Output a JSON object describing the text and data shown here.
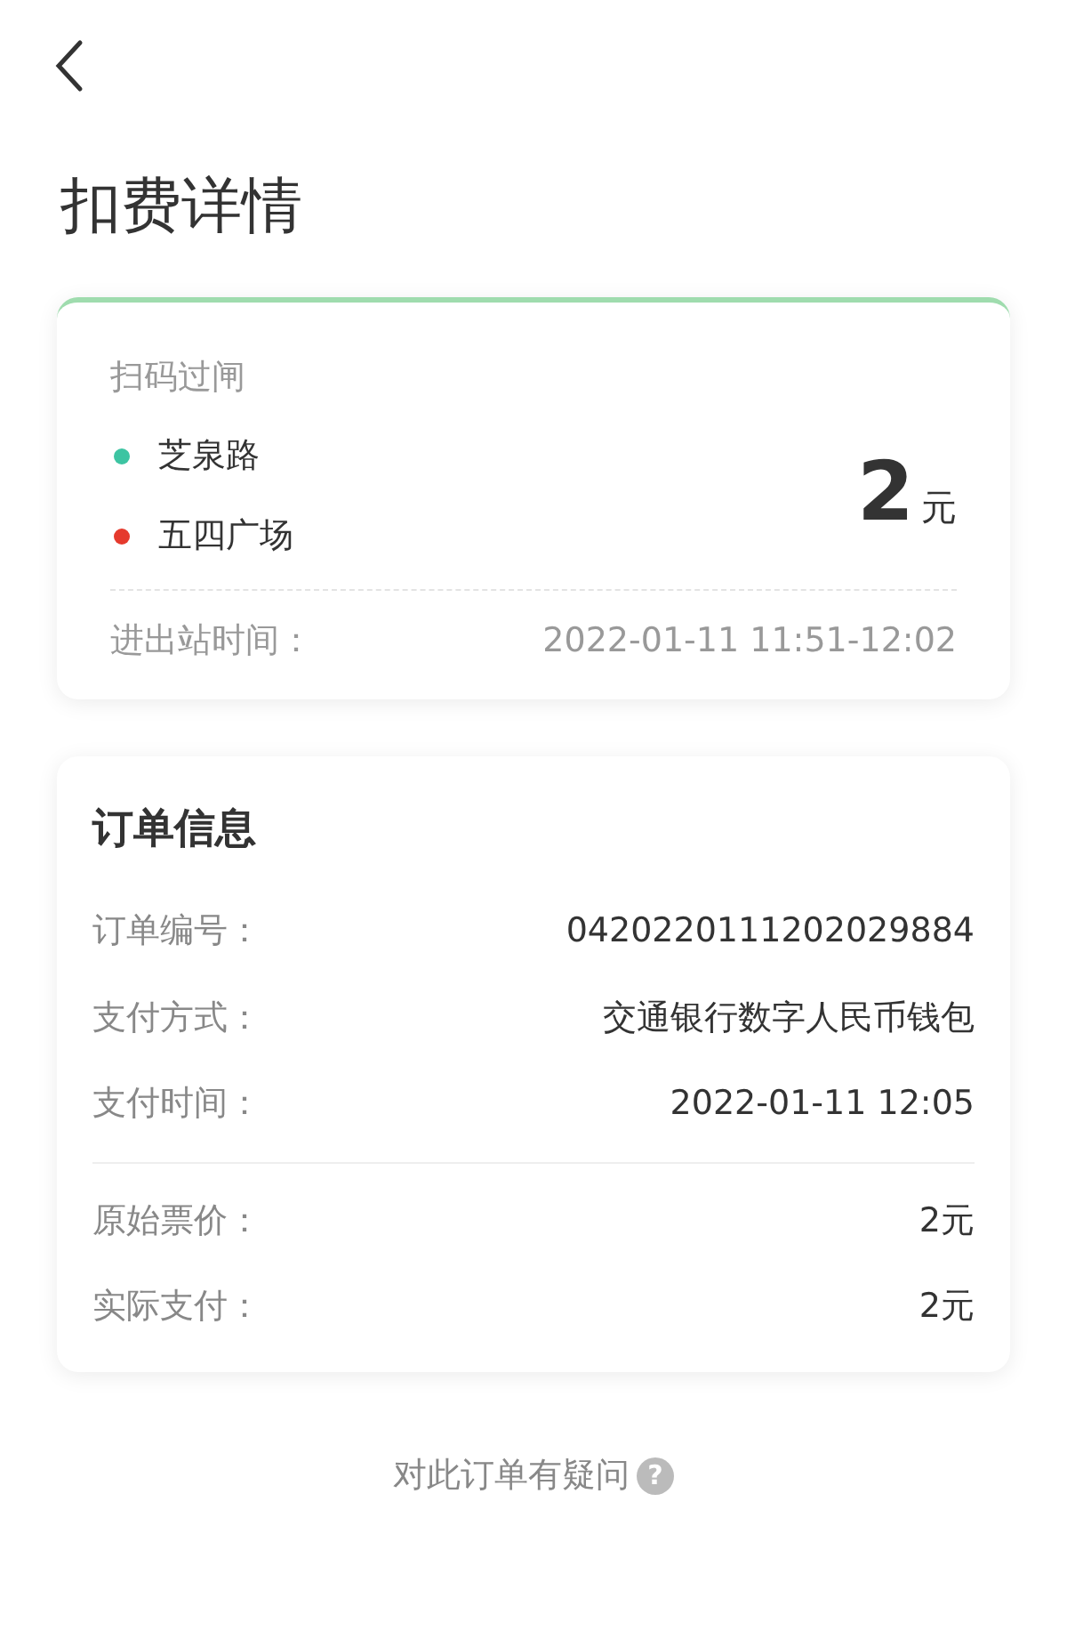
{
  "title": "扣费详情",
  "trip": {
    "label": "扫码过闸",
    "stations": [
      {
        "name": "芝泉路",
        "color": "#3dc4a2"
      },
      {
        "name": "五四广场",
        "color": "#e53a2d"
      }
    ],
    "amount": "2",
    "unit": "元",
    "time_label": "进出站时间：",
    "time": "2022-01-11 11:51-12:02"
  },
  "order": {
    "title": "订单信息",
    "groups": [
      [
        {
          "label": "订单编号：",
          "value": "0420220111202029884"
        },
        {
          "label": "支付方式：",
          "value": "交通银行数字人民币钱包"
        },
        {
          "label": "支付时间：",
          "value": "2022-01-11 12:05"
        }
      ],
      [
        {
          "label": "原始票价：",
          "value": "2元"
        },
        {
          "label": "实际支付：",
          "value": "2元"
        }
      ]
    ]
  },
  "help": {
    "text": "对此订单有疑问",
    "icon": "?"
  }
}
